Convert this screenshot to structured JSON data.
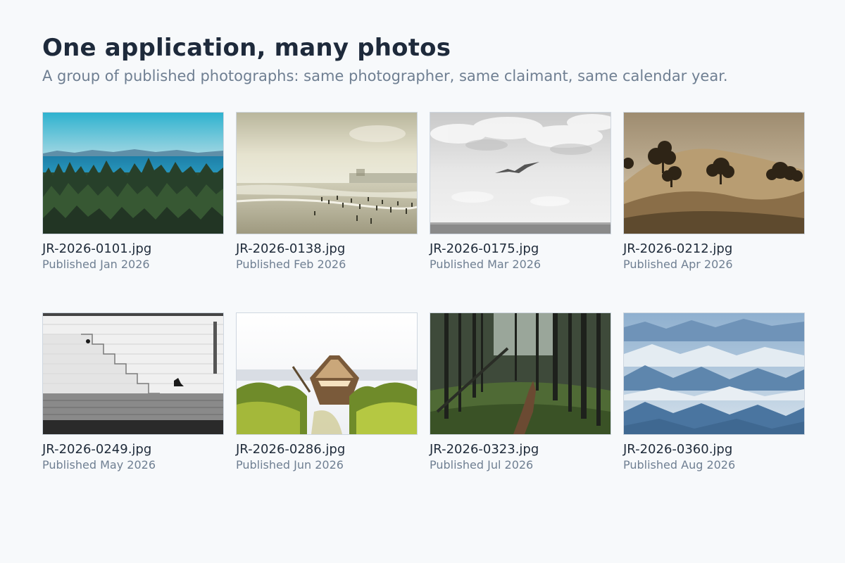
{
  "header": {
    "title": "One application, many photos",
    "subtitle": "A group of published photographs: same photographer, same claimant, same calendar year."
  },
  "photos": [
    {
      "filename": "JR-2026-0101.jpg",
      "published": "Published Jan 2026",
      "scene": "coastal-forest-photo"
    },
    {
      "filename": "JR-2026-0138.jpg",
      "published": "Published Feb 2026",
      "scene": "beach-crowd-photo"
    },
    {
      "filename": "JR-2026-0175.jpg",
      "published": "Published Mar 2026",
      "scene": "seagull-sky-photo"
    },
    {
      "filename": "JR-2026-0212.jpg",
      "published": "Published Apr 2026",
      "scene": "sepia-hills-trees-photo"
    },
    {
      "filename": "JR-2026-0249.jpg",
      "published": "Published May 2026",
      "scene": "stone-stairs-wall-photo"
    },
    {
      "filename": "JR-2026-0286.jpg",
      "published": "Published Jun 2026",
      "scene": "canoe-bushes-photo"
    },
    {
      "filename": "JR-2026-0323.jpg",
      "published": "Published Jul 2026",
      "scene": "forest-path-photo"
    },
    {
      "filename": "JR-2026-0360.jpg",
      "published": "Published Aug 2026",
      "scene": "misty-mountains-photo"
    }
  ]
}
